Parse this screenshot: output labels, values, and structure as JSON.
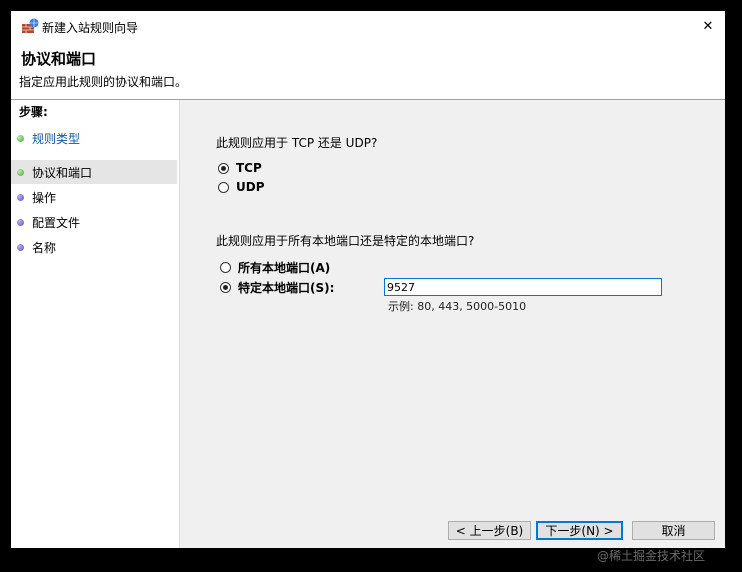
{
  "window": {
    "title": "新建入站规则向导",
    "close_glyph": "✕"
  },
  "header": {
    "title": "协议和端口",
    "subtitle": "指定应用此规则的协议和端口。"
  },
  "steps": {
    "title": "步骤:",
    "items": [
      {
        "label": "规则类型",
        "bullet": "green",
        "state": "link"
      },
      {
        "label": "协议和端口",
        "bullet": "green",
        "state": "active"
      },
      {
        "label": "操作",
        "bullet": "purple",
        "state": "normal"
      },
      {
        "label": "配置文件",
        "bullet": "purple",
        "state": "normal"
      },
      {
        "label": "名称",
        "bullet": "purple",
        "state": "normal"
      }
    ]
  },
  "main": {
    "protocol_question": "此规则应用于 TCP 还是 UDP?",
    "protocol_options": [
      {
        "label": "TCP",
        "checked": true
      },
      {
        "label": "UDP",
        "checked": false
      }
    ],
    "port_question": "此规则应用于所有本地端口还是特定的本地端口?",
    "port_options": [
      {
        "label": "所有本地端口(A)",
        "checked": false
      },
      {
        "label": "特定本地端口(S):",
        "checked": true
      }
    ],
    "port_value": "9527",
    "port_example": "示例: 80, 443, 5000-5010"
  },
  "buttons": {
    "back": "< 上一步(B)",
    "next": "下一步(N) >",
    "cancel": "取消"
  },
  "watermark": "@稀土掘金技术社区",
  "colors": {
    "link": "#0b5aa8",
    "focus": "#0078d7",
    "bullet_done": "#4ba43a",
    "bullet_pending": "#5a4cc2"
  }
}
